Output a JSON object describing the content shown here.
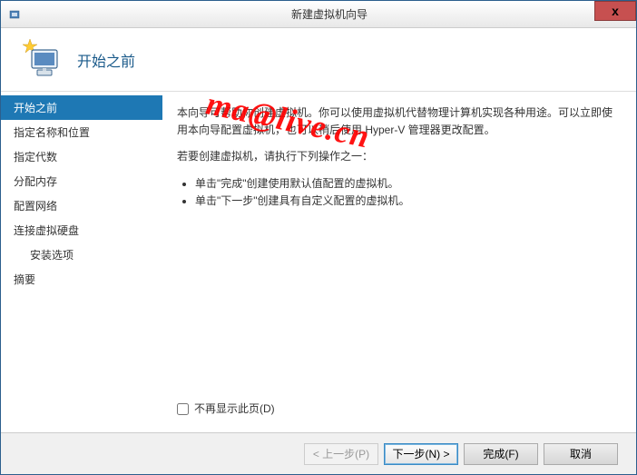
{
  "window": {
    "title": "新建虚拟机向导",
    "close_symbol": "x"
  },
  "header": {
    "title": "开始之前"
  },
  "sidebar": {
    "items": [
      {
        "label": "开始之前",
        "active": true
      },
      {
        "label": "指定名称和位置",
        "active": false
      },
      {
        "label": "指定代数",
        "active": false
      },
      {
        "label": "分配内存",
        "active": false
      },
      {
        "label": "配置网络",
        "active": false
      },
      {
        "label": "连接虚拟硬盘",
        "active": false
      },
      {
        "label": "安装选项",
        "active": false,
        "indented": true
      },
      {
        "label": "摘要",
        "active": false
      }
    ]
  },
  "content": {
    "para1": "本向导可帮助你创建虚拟机。你可以使用虚拟机代替物理计算机实现各种用途。可以立即使用本向导配置虚拟机，也可以稍后使用 Hyper-V 管理器更改配置。",
    "para2": "若要创建虚拟机，请执行下列操作之一：",
    "bullet1": "单击\"完成\"创建使用默认值配置的虚拟机。",
    "bullet2": "单击\"下一步\"创建具有自定义配置的虚拟机。",
    "checkbox_label": "不再显示此页(D)"
  },
  "footer": {
    "prev": "< 上一步(P)",
    "next": "下一步(N) >",
    "finish": "完成(F)",
    "cancel": "取消"
  },
  "watermark": "ma@live.cn"
}
